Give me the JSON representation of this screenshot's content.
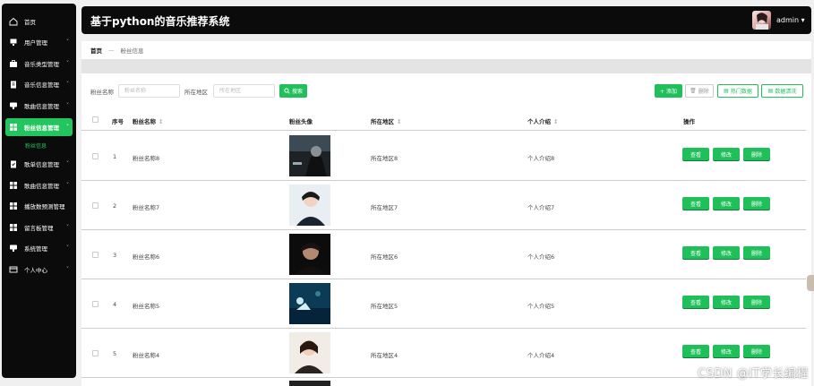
{
  "app": {
    "title": "基于python的音乐推荐系统",
    "user": "admin",
    "user_chevron": "▾"
  },
  "sidebar": {
    "items": [
      {
        "label": "首页",
        "icon": "home-icon",
        "has_chevron": false
      },
      {
        "label": "用户管理",
        "icon": "user-icon",
        "has_chevron": true
      },
      {
        "label": "音乐类型管理",
        "icon": "briefcase-icon",
        "has_chevron": true
      },
      {
        "label": "音乐信息管理",
        "icon": "clipboard-icon",
        "has_chevron": true
      },
      {
        "label": "歌曲信息管理",
        "icon": "chat-icon",
        "has_chevron": true
      },
      {
        "label": "粉丝信息管理",
        "icon": "grid-icon",
        "has_chevron": true,
        "active": true
      },
      {
        "label": "歌单信息管理",
        "icon": "clipboard-check-icon",
        "has_chevron": true
      },
      {
        "label": "歌曲信息管理",
        "icon": "grid-icon",
        "has_chevron": true
      },
      {
        "label": "播放数预测管理",
        "icon": "grid-icon",
        "has_chevron": false
      },
      {
        "label": "留言板管理",
        "icon": "grid-icon",
        "has_chevron": true
      },
      {
        "label": "系统管理",
        "icon": "chat-icon",
        "has_chevron": true
      },
      {
        "label": "个人中心",
        "icon": "id-card-icon",
        "has_chevron": true
      }
    ],
    "sub_item": "粉丝信息",
    "chevron": "˅",
    "chevron_up": "˄"
  },
  "breadcrumb": {
    "home": "首页",
    "separator": "—",
    "current": "粉丝信息"
  },
  "search": {
    "name_label": "粉丝名称",
    "name_placeholder": "粉丝名称",
    "area_label": "所在地区",
    "area_placeholder": "所在地区",
    "search_button": "搜索"
  },
  "toolbar": {
    "add": "+ 添加",
    "delete": "删除",
    "hot": "热门数据",
    "clean": "数据清洗"
  },
  "table": {
    "columns": [
      "序号",
      "粉丝名称",
      "粉丝头像",
      "所在地区",
      "个人介绍",
      "操作"
    ],
    "sort_glyph": "↕",
    "rows": [
      {
        "index": "1",
        "name": "粉丝名称8",
        "area": "所在地区8",
        "intro": "个人介绍8",
        "thumb": "dark-figure"
      },
      {
        "index": "2",
        "name": "粉丝名称7",
        "area": "所在地区7",
        "intro": "个人介绍7",
        "thumb": "light-portrait"
      },
      {
        "index": "3",
        "name": "粉丝名称6",
        "area": "所在地区6",
        "intro": "个人介绍6",
        "thumb": "dark-portrait"
      },
      {
        "index": "4",
        "name": "粉丝名称5",
        "area": "所在地区5",
        "intro": "个人介绍5",
        "thumb": "underwater"
      },
      {
        "index": "5",
        "name": "粉丝名称4",
        "area": "所在地区4",
        "intro": "个人介绍4",
        "thumb": "warm-portrait"
      }
    ],
    "actions": {
      "view": "查看",
      "edit": "修改",
      "delete": "删除"
    }
  },
  "watermark": "CSDN @IT学长编程",
  "colors": {
    "accent": "#1fbf5a",
    "sidebar_bg": "#0b0b0b",
    "active_item": "#23c55e"
  }
}
